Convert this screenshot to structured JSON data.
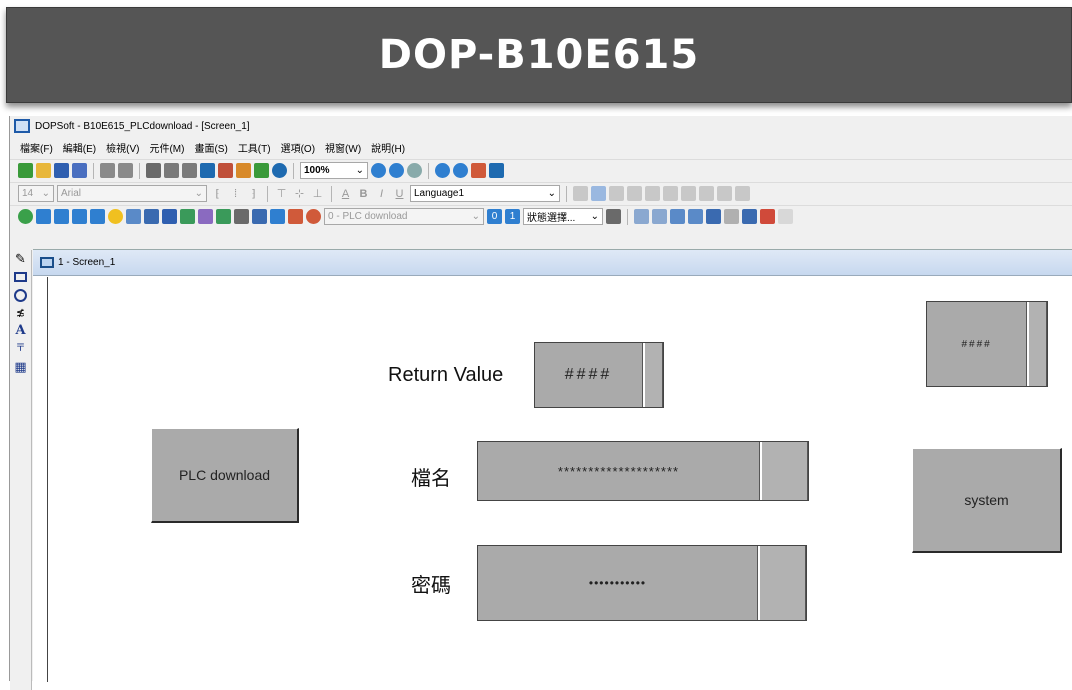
{
  "banner": {
    "title": "DOP-B10E615"
  },
  "window": {
    "title": "DOPSoft - B10E615_PLCdownload - [Screen_1]"
  },
  "menu": [
    "檔案(F)",
    "編輯(E)",
    "檢視(V)",
    "元件(M)",
    "畫面(S)",
    "工具(T)",
    "選項(O)",
    "視窗(W)",
    "說明(H)"
  ],
  "toolbar": {
    "zoom": "100%",
    "font_size": "14",
    "font_name": "Arial",
    "language": "Language1",
    "screen_select": "0 - PLC download",
    "state_select": "狀態選擇...",
    "state_btn_0": "0",
    "state_btn_1": "1"
  },
  "doc": {
    "tab_label": "1 - Screen_1"
  },
  "canvas": {
    "return_value_label": "Return Value",
    "return_value_display": "####",
    "corner_display": "####",
    "plc_download_button": "PLC download",
    "filename_label": "檔名",
    "filename_value": "********************",
    "password_label": "密碼",
    "password_value": "•••••••••••",
    "system_button": "system"
  }
}
